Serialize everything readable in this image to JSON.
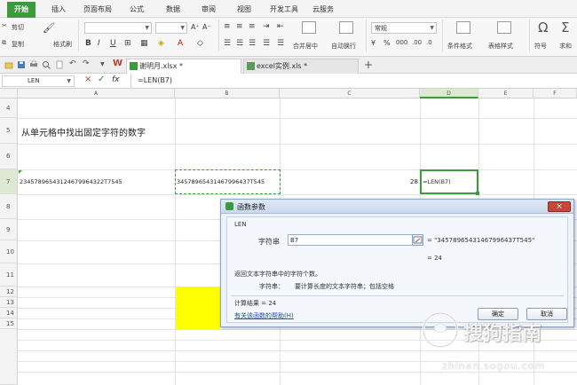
{
  "ribbon_tabs": [
    "开始",
    "插入",
    "页面布局",
    "公式",
    "数据",
    "审阅",
    "视图",
    "开发工具",
    "云服务"
  ],
  "toolbar": {
    "cut": "剪切",
    "copy": "复制",
    "format_painter": "格式刷",
    "bold": "B",
    "italic": "I",
    "underline": "U",
    "merge_center": "合并居中",
    "wrap_text": "自动换行",
    "number_format": "常规",
    "conditional_format": "条件格式",
    "table_style": "表格样式",
    "symbol": "符号",
    "sum": "求和"
  },
  "doc_tabs": [
    {
      "name": "谢明月.xlsx *"
    },
    {
      "name": "excel实例.xls *"
    }
  ],
  "formula_bar": {
    "name_box": "LEN",
    "cancel": "×",
    "confirm": "✓",
    "fx": "fx",
    "formula": "=LEN(B7)"
  },
  "columns": [
    "A",
    "B",
    "C",
    "D",
    "E",
    "F"
  ],
  "rows": [
    "4",
    "5",
    "6",
    "7",
    "8",
    "9",
    "10",
    "11",
    "12",
    "13",
    "14",
    "15"
  ],
  "cells": {
    "A5": "从单元格中找出固定字符的数字",
    "A7": "23457896543124679964322T7545",
    "B7": "34578965431467996437T545",
    "C7": "28",
    "D7": "=LEN(B7)"
  },
  "highlight_color": "#ffff00",
  "accent_color": "#3b9b3b",
  "dialog": {
    "title": "函数参数",
    "function_name": "LEN",
    "arg_label": "字符串",
    "arg_value": "B7",
    "arg_result": "= \"34578965431467996437T545\"",
    "result_line": "= 24",
    "description": "返回文本字符串中的字符个数。",
    "arg_desc_label": "字符串：",
    "arg_desc": "要计算长度的文本字符串；包括空格",
    "calc_result": "计算结果 = 24",
    "help_link": "有关该函数的帮助(H)",
    "ok": "确定",
    "cancel": "取消",
    "close": "×"
  },
  "watermark": {
    "brand": "搜狗指南",
    "url": "zhinan.sogou.com"
  }
}
